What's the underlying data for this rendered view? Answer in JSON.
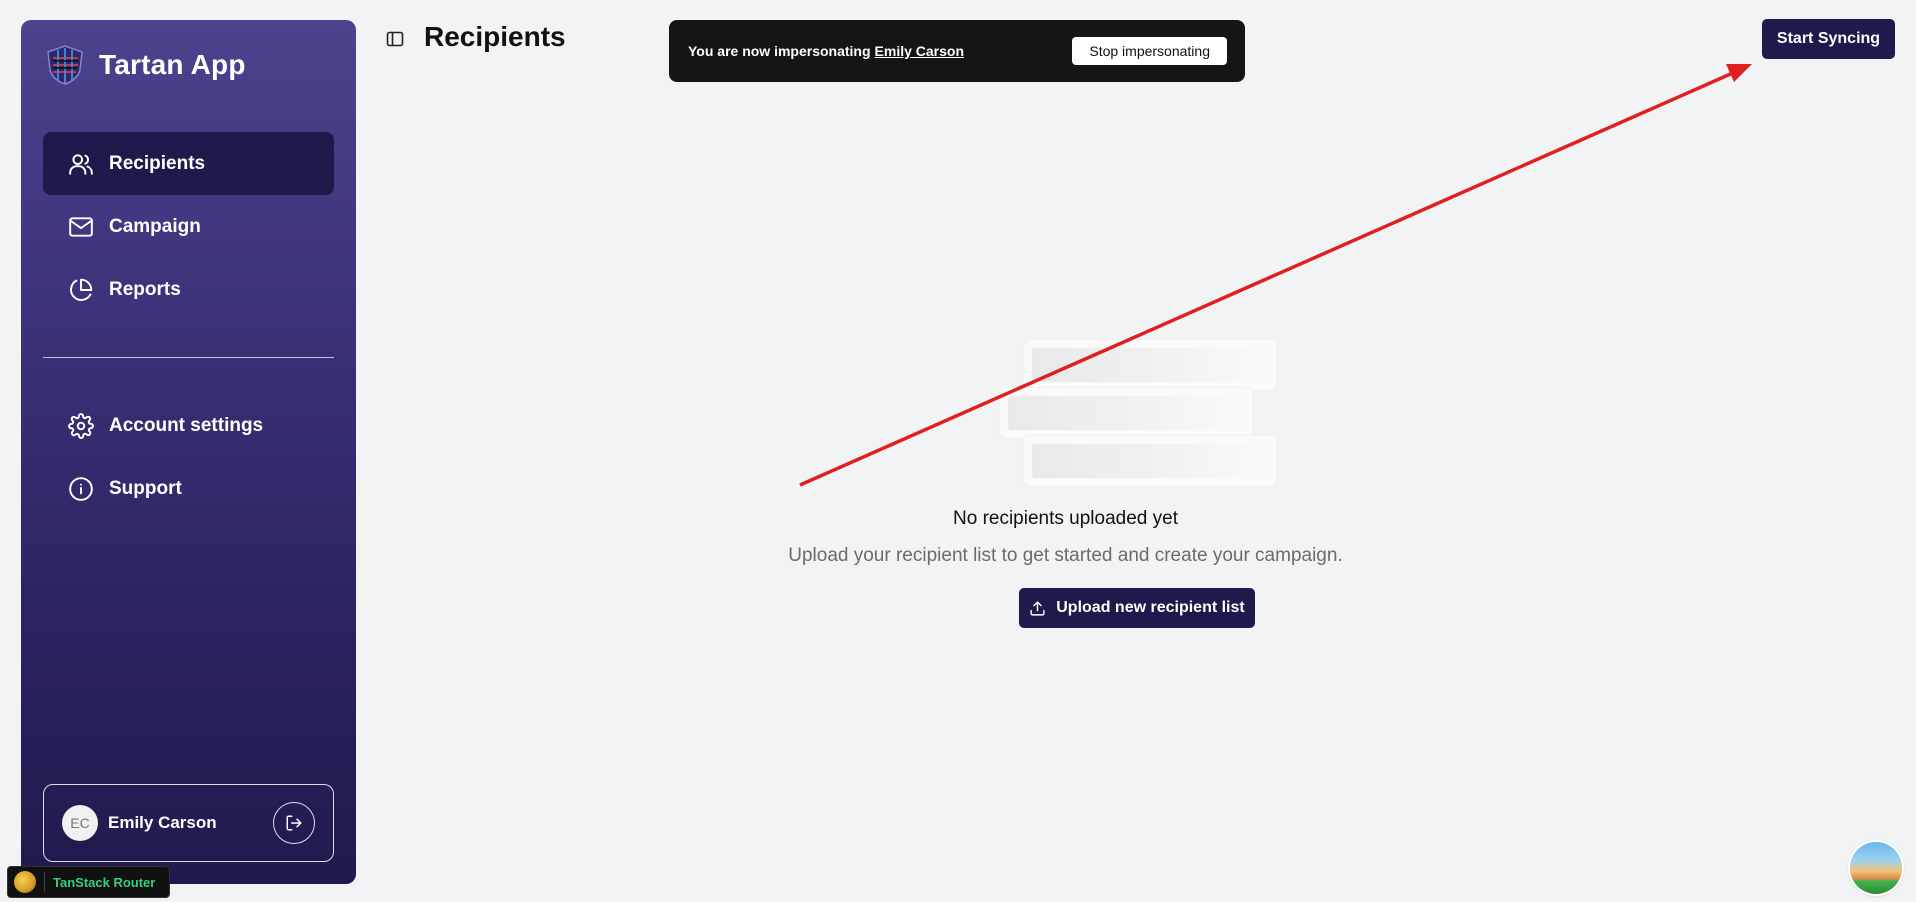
{
  "app": {
    "name": "Tartan App"
  },
  "sidebar": {
    "items": [
      {
        "label": "Recipients",
        "icon": "users-icon",
        "active": true
      },
      {
        "label": "Campaign",
        "icon": "mail-icon",
        "active": false
      },
      {
        "label": "Reports",
        "icon": "pie-chart-icon",
        "active": false
      }
    ],
    "items_secondary": [
      {
        "label": "Account settings",
        "icon": "gear-icon"
      },
      {
        "label": "Support",
        "icon": "info-icon"
      }
    ],
    "user": {
      "initials": "EC",
      "name": "Emily Carson"
    }
  },
  "header": {
    "title": "Recipients",
    "sync_button": "Start Syncing"
  },
  "impersonation": {
    "prefix": "You are now impersonating",
    "user": "Emily Carson",
    "stop_label": "Stop impersonating"
  },
  "empty_state": {
    "title": "No recipients uploaded yet",
    "subtitle": "Upload your recipient list to get started and create your campaign.",
    "upload_button": "Upload new recipient list"
  },
  "devtools": {
    "label": "TanStack Router"
  },
  "colors": {
    "accent": "#1e1a4c",
    "annotation_arrow": "#e02020"
  }
}
